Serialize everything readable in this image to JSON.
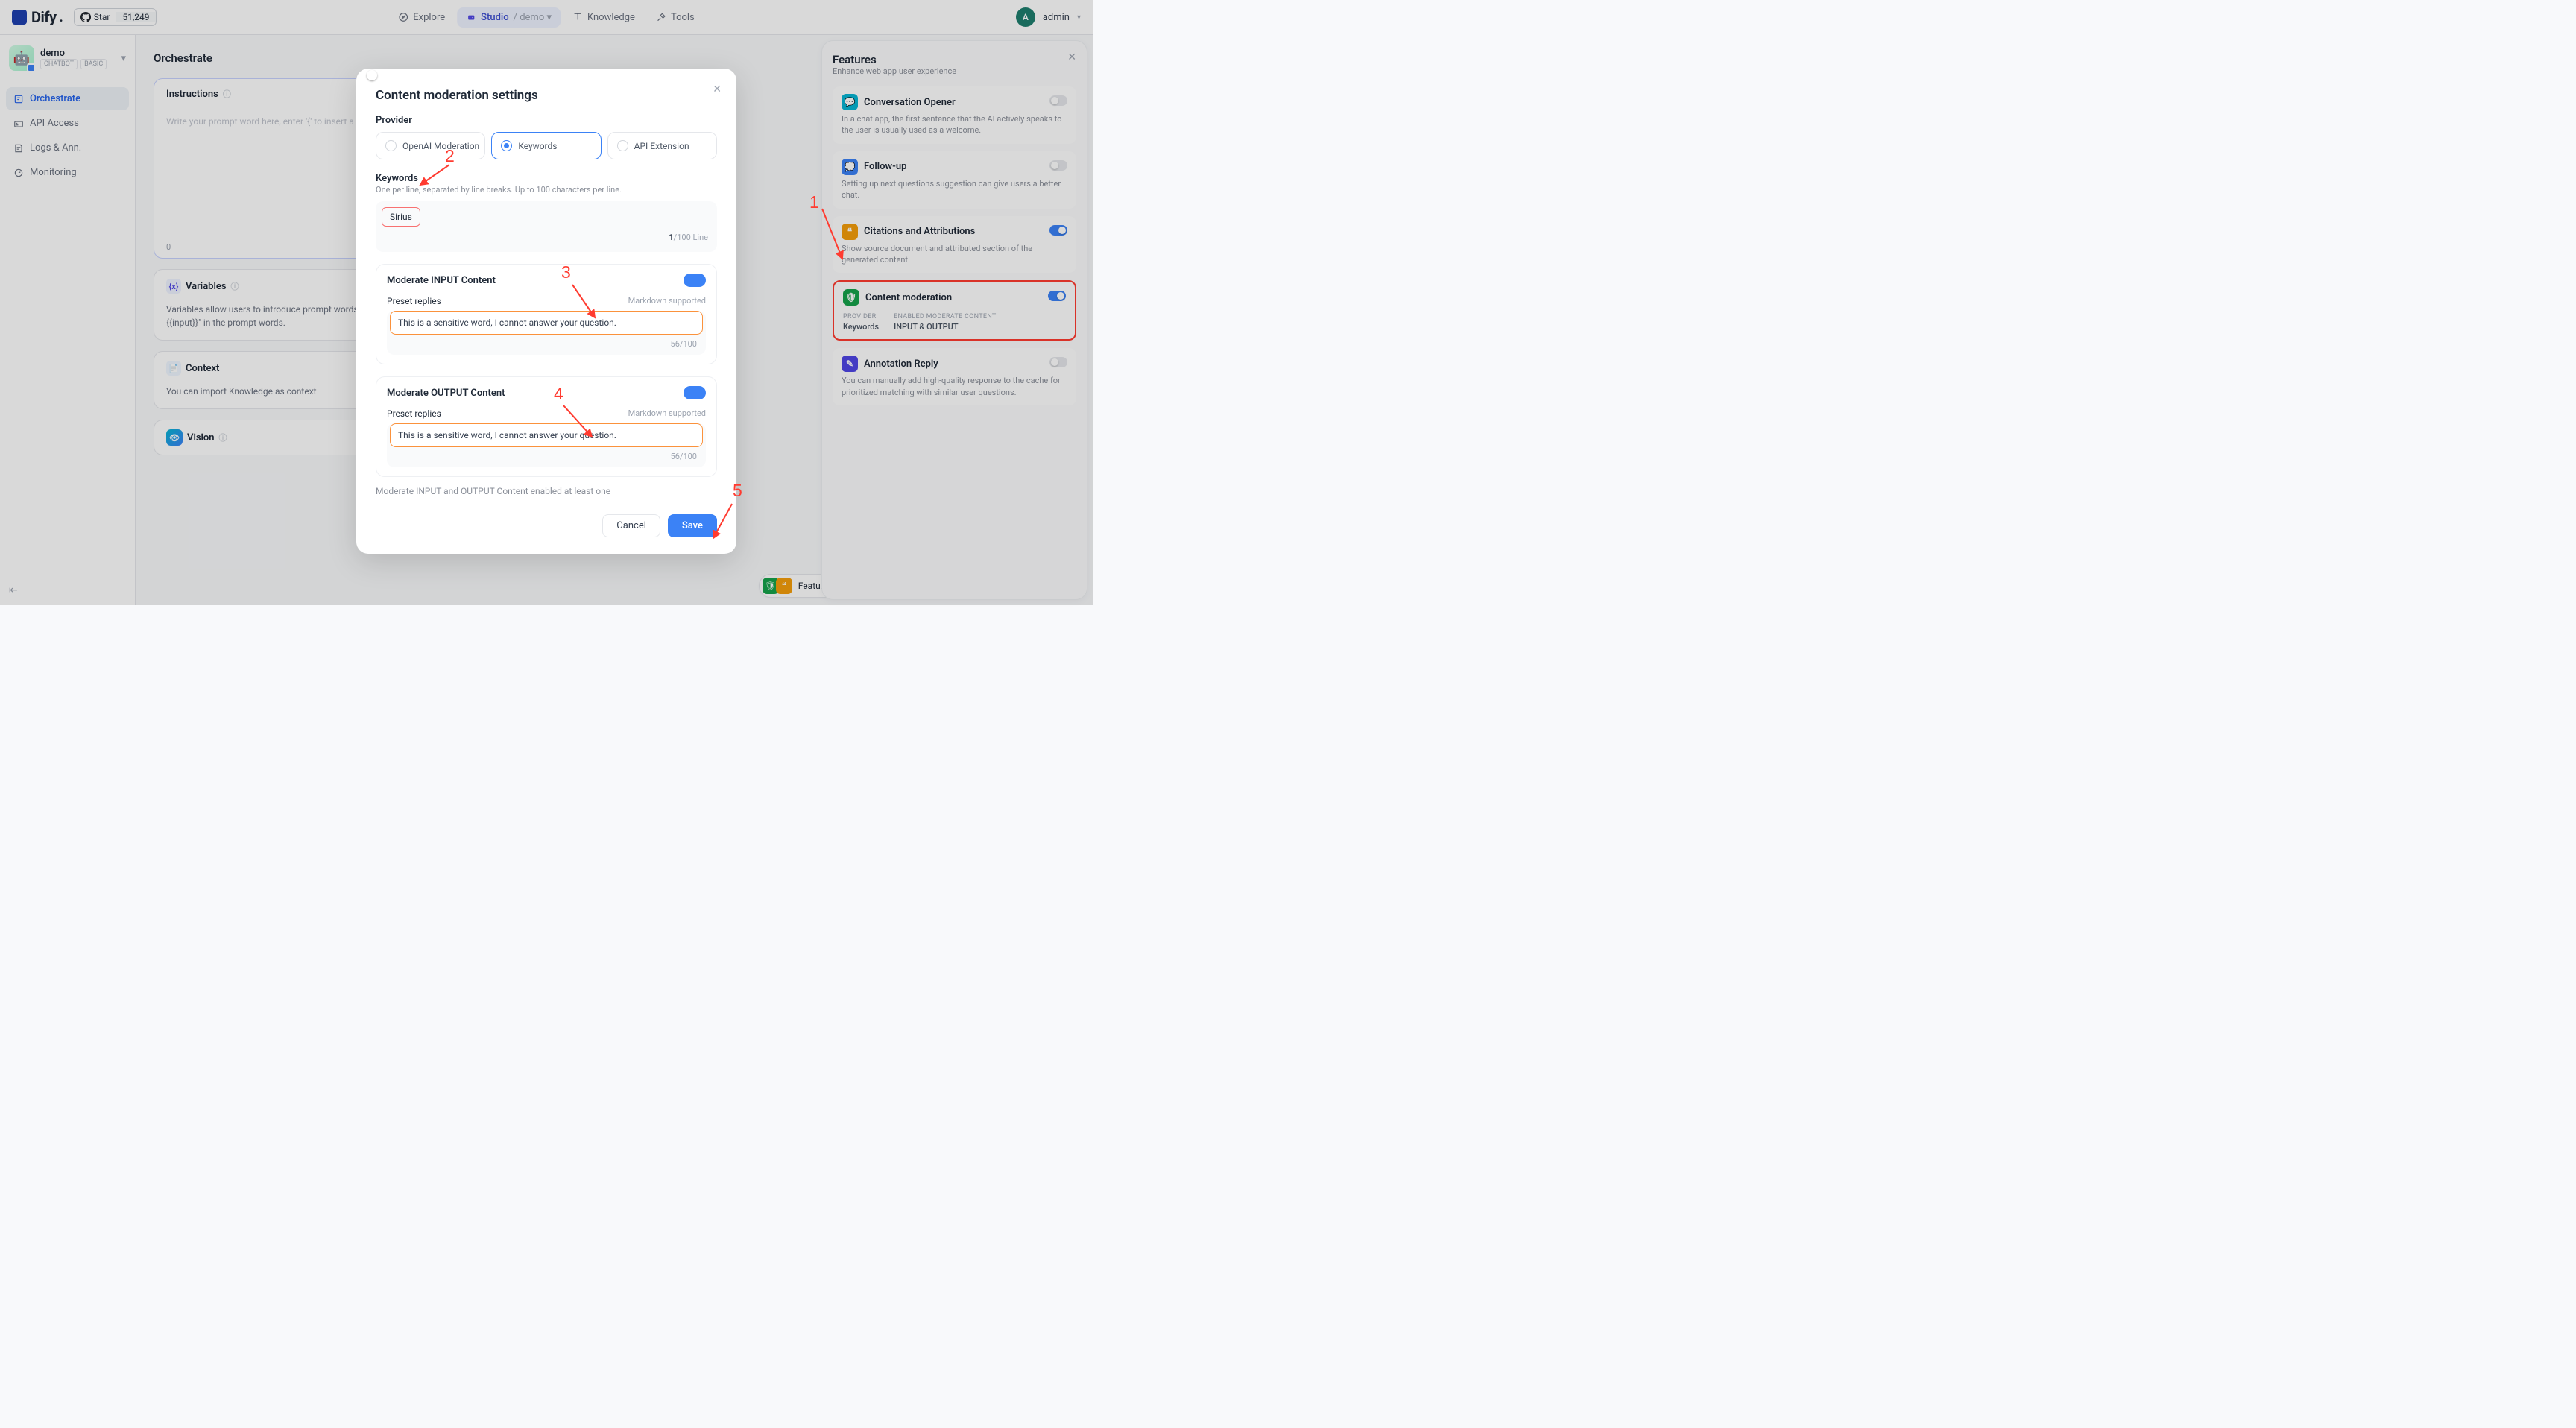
{
  "header": {
    "logo_text": "Dify",
    "gh_star_label": "Star",
    "gh_star_count": "51,249",
    "nav": {
      "explore": "Explore",
      "studio": "Studio",
      "studio_app": "demo",
      "knowledge": "Knowledge",
      "tools": "Tools"
    },
    "user_initial": "A",
    "user_name": "admin"
  },
  "sidebar": {
    "app_name": "demo",
    "tag1": "CHATBOT",
    "tag2": "BASIC",
    "items": [
      "Orchestrate",
      "API Access",
      "Logs & Ann.",
      "Monitoring"
    ]
  },
  "main": {
    "title": "Orchestrate",
    "instructions_label": "Instructions",
    "instructions_placeholder": "Write your prompt word here, enter '{' to insert a v",
    "instructions_count": "0",
    "variables_label": "Variables",
    "variables_desc": "Variables allow users to introduce prompt words or op\n{{input}}\" in the prompt words.",
    "context_label": "Context",
    "context_desc": "You can import Knowledge as context",
    "vision_label": "Vision"
  },
  "features_pill": "Features Enabled",
  "features_panel": {
    "title": "Features",
    "subtitle": "Enhance web app user experience",
    "cards": [
      {
        "title": "Conversation Opener",
        "desc": "In a chat app, the first sentence that the AI actively speaks to the user is usually used as a welcome.",
        "on": false,
        "color": "#06b6d4"
      },
      {
        "title": "Follow-up",
        "desc": "Setting up next questions suggestion can give users a better chat.",
        "on": false,
        "color": "#3b82f6"
      },
      {
        "title": "Citations and Attributions",
        "desc": "Show source document and attributed section of the generated content.",
        "on": true,
        "color": "#f59e0b"
      },
      {
        "title": "Content moderation",
        "on": true,
        "color": "#16a34a",
        "highlight": true,
        "meta": [
          [
            "PROVIDER",
            "Keywords"
          ],
          [
            "ENABLED MODERATE CONTENT",
            "INPUT & OUTPUT"
          ]
        ]
      },
      {
        "title": "Annotation Reply",
        "desc": "You can manually add high-quality response to the cache for prioritized matching with similar user questions.",
        "on": false,
        "color": "#4f46e5"
      }
    ]
  },
  "modal": {
    "title": "Content moderation settings",
    "provider_label": "Provider",
    "providers": [
      "OpenAI Moderation",
      "Keywords",
      "API Extension"
    ],
    "keywords_label": "Keywords",
    "keywords_sublabel": "One per line, separated by line breaks. Up to 100 characters per line.",
    "keyword_value": "Sirius",
    "kw_count_cur": "1",
    "kw_count_max": "/100 Line",
    "sections": [
      {
        "title": "Moderate INPUT Content",
        "preset": "Preset replies",
        "markdown": "Markdown supported",
        "value": "This is a sensitive word, I cannot answer your question.",
        "cur": "56",
        "max": "/100"
      },
      {
        "title": "Moderate OUTPUT Content",
        "preset": "Preset replies",
        "markdown": "Markdown supported",
        "value": "This is a sensitive word, I cannot answer your question.",
        "cur": "56",
        "max": "/100"
      }
    ],
    "note": "Moderate INPUT and OUTPUT Content enabled at least one",
    "cancel": "Cancel",
    "save": "Save"
  },
  "annotations": {
    "a1": "1",
    "a2": "2",
    "a3": "3",
    "a4": "4",
    "a5": "5"
  }
}
